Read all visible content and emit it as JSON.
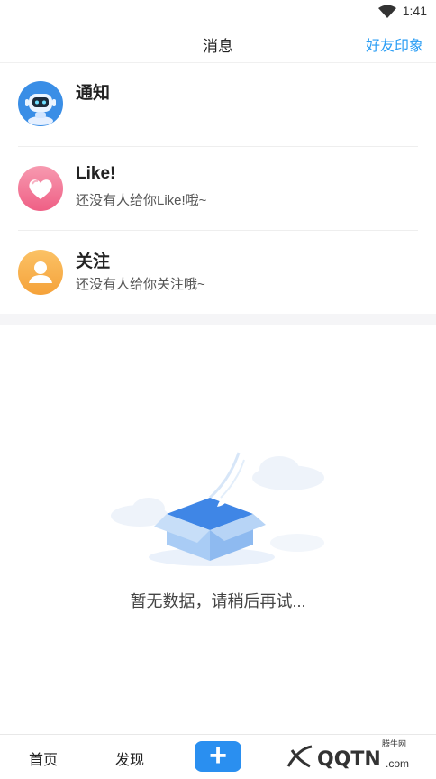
{
  "status_bar": {
    "time": "1:41",
    "wifi_icon": "wifi-icon"
  },
  "header": {
    "title": "消息",
    "right_link": "好友印象"
  },
  "messages": [
    {
      "name": "通知",
      "desc": "",
      "icon": "robot-avatar-icon",
      "color": "#3a8ee6"
    },
    {
      "name": "Like!",
      "desc": "还没有人给你Like!哦~",
      "icon": "heart-icon",
      "color": "#f06e8e"
    },
    {
      "name": "关注",
      "desc": "还没有人给你关注哦~",
      "icon": "person-icon",
      "color": "#f7a940"
    }
  ],
  "empty_state": {
    "text": "暂无数据，请稍后再试...",
    "icon": "empty-box-icon"
  },
  "bottom_nav": {
    "home": "首页",
    "discover": "发现",
    "add_icon": "plus-icon",
    "add_label": "+"
  },
  "watermark": {
    "text": "QQTN",
    "suffix": ".com",
    "small": "腾牛网"
  },
  "colors": {
    "accent": "#2a9df4",
    "add_button": "#2a8ff0"
  }
}
